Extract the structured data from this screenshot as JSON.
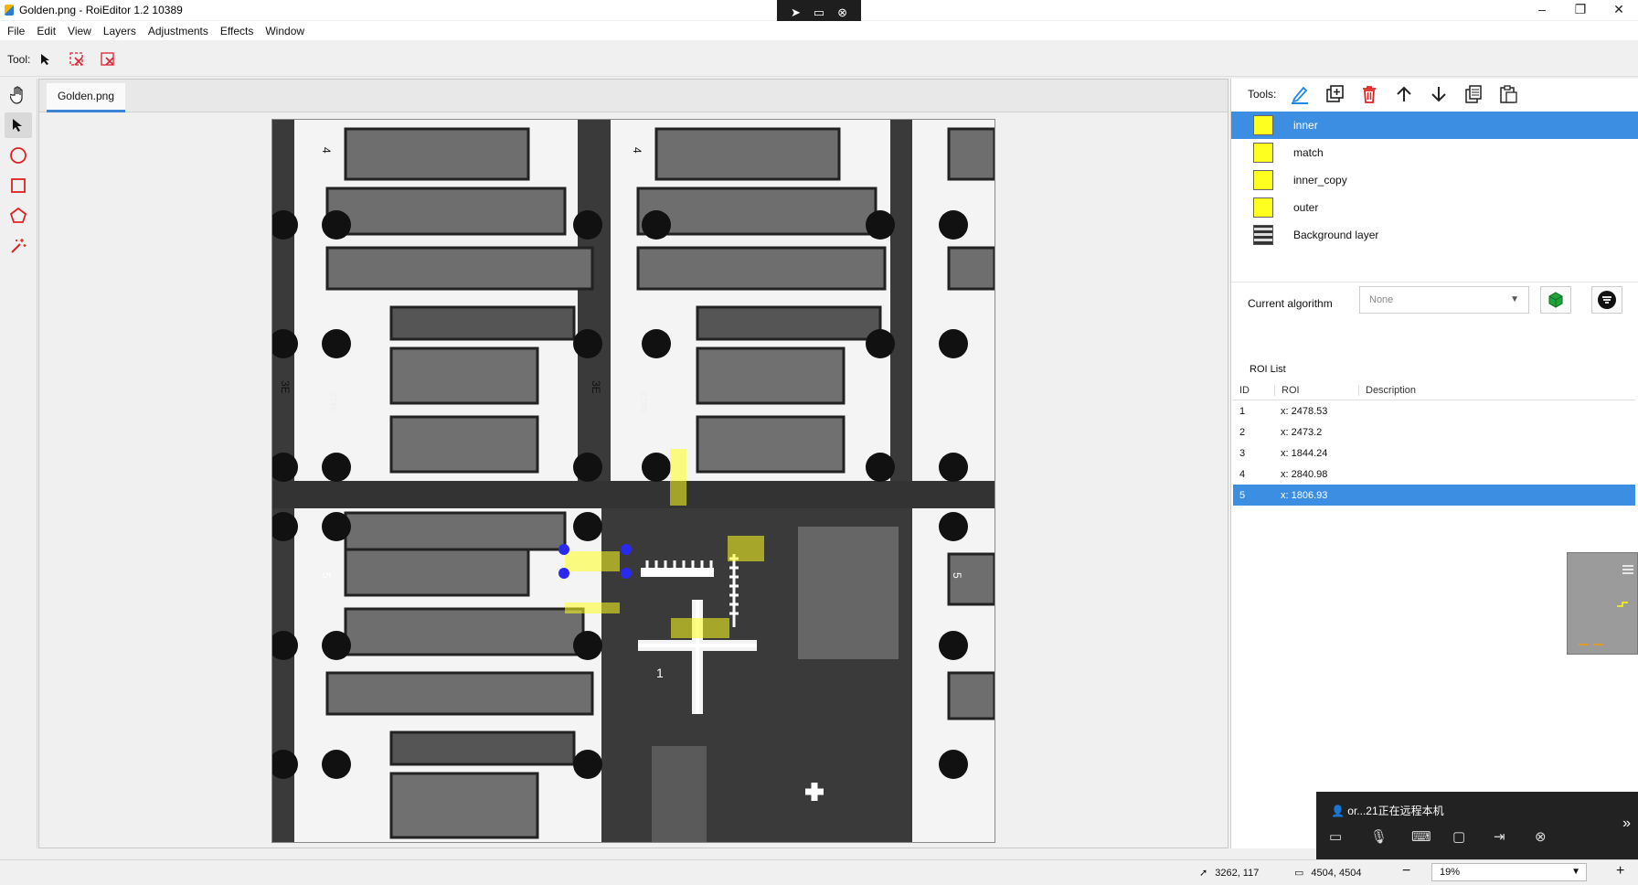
{
  "window": {
    "title": "Golden.png - RoiEditor 1.2 10389"
  },
  "menu": [
    "File",
    "Edit",
    "View",
    "Layers",
    "Adjustments",
    "Effects",
    "Window"
  ],
  "toolbar": {
    "tool_label": "Tool:"
  },
  "document": {
    "tab_label": "Golden.png"
  },
  "right_panel": {
    "tools_label": "Tools:",
    "layers": [
      {
        "name": "inner",
        "color": "#ffff1f",
        "selected": true
      },
      {
        "name": "match",
        "color": "#ffff1f"
      },
      {
        "name": "inner_copy",
        "color": "#ffff1f"
      },
      {
        "name": "outer",
        "color": "#ffff1f"
      },
      {
        "name": "Background layer",
        "icon": "image-thumbnail-icon"
      }
    ],
    "algorithm": {
      "label": "Current algorithm",
      "selected": "None"
    },
    "roi_list": {
      "title": "ROI List",
      "headers": [
        "ID",
        "ROI",
        "Description"
      ],
      "rows": [
        {
          "id": "1",
          "roi": "x: 2478.53",
          "desc": ""
        },
        {
          "id": "2",
          "roi": "x: 2473.2",
          "desc": ""
        },
        {
          "id": "3",
          "roi": "x: 1844.24",
          "desc": ""
        },
        {
          "id": "4",
          "roi": "x: 2840.98",
          "desc": ""
        },
        {
          "id": "5",
          "roi": "x: 1806.93",
          "desc": ""
        }
      ]
    }
  },
  "canvas_labels": {
    "l1": "4",
    "l2": "4",
    "l3": "3E",
    "l4": "3E",
    "l5": "0423",
    "l6": "0423",
    "l7": "5",
    "l8": "5",
    "l9": "1"
  },
  "remote": {
    "text": "or...21正在远程本机"
  },
  "status": {
    "cursor": "3262, 117",
    "size": "4504, 4504",
    "zoom": "19%"
  },
  "colors": {
    "accent": "#3c8ee3",
    "roi_fill": "#ffff1f",
    "handle": "#2a2aee"
  }
}
